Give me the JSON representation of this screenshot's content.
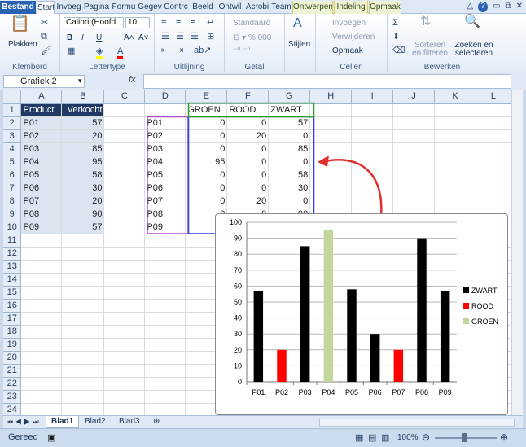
{
  "ribbon_tabs": [
    "Bestand",
    "Start",
    "Invoeg",
    "Pagina",
    "Formu",
    "Gegev",
    "Contrc",
    "Beeld",
    "Ontwil",
    "Acrobi",
    "Team",
    "Ontwerpen",
    "Indeling",
    "Opmaak"
  ],
  "ribbon": {
    "clipboard": {
      "paste": "Plakken",
      "group": "Klembord"
    },
    "font": {
      "name": "Calibri (Hoofd",
      "size": "10",
      "group": "Lettertype"
    },
    "align": {
      "group": "Uitlijning"
    },
    "number": {
      "format": "Standaard",
      "group": "Getal"
    },
    "styles": {
      "label": "Stijlen"
    },
    "cells": {
      "insert": "Invoegen",
      "delete": "Verwijderen",
      "format": "Opmaak",
      "group": "Cellen"
    },
    "edit": {
      "sort": "Sorteren en filteren",
      "find": "Zoeken en selecteren",
      "group": "Bewerken"
    }
  },
  "namebox": "Grafiek 2",
  "fx": "fx",
  "columns": [
    "",
    "A",
    "B",
    "C",
    "D",
    "E",
    "F",
    "G",
    "H",
    "I",
    "J",
    "K",
    "L"
  ],
  "rows": [
    [
      "Product",
      "Verkocht",
      "",
      "",
      "GROEN",
      "ROOD",
      "ZWART"
    ],
    [
      "P01",
      "57",
      "",
      "P01",
      "0",
      "0",
      "57"
    ],
    [
      "P02",
      "20",
      "",
      "P02",
      "0",
      "20",
      "0"
    ],
    [
      "P03",
      "85",
      "",
      "P03",
      "0",
      "0",
      "85"
    ],
    [
      "P04",
      "95",
      "",
      "P04",
      "95",
      "0",
      "0"
    ],
    [
      "P05",
      "58",
      "",
      "P05",
      "0",
      "0",
      "58"
    ],
    [
      "P06",
      "30",
      "",
      "P06",
      "0",
      "0",
      "30"
    ],
    [
      "P07",
      "20",
      "",
      "P07",
      "0",
      "20",
      "0"
    ],
    [
      "P08",
      "90",
      "",
      "P08",
      "0",
      "0",
      "90"
    ],
    [
      "P09",
      "57",
      "",
      "P09",
      "",
      "",
      ""
    ],
    [
      "",
      "",
      "",
      "",
      "",
      "",
      ""
    ],
    [
      "",
      "",
      "",
      "",
      "",
      "",
      ""
    ],
    [
      "",
      "",
      "",
      "",
      "",
      "",
      ""
    ],
    [
      "",
      "",
      "",
      "",
      "",
      "",
      ""
    ],
    [
      "",
      "",
      "",
      "",
      "",
      "",
      ""
    ],
    [
      "",
      "",
      "",
      "",
      "",
      "",
      ""
    ],
    [
      "",
      "",
      "",
      "",
      "",
      "",
      ""
    ],
    [
      "",
      "",
      "",
      "",
      "",
      "",
      ""
    ],
    [
      "",
      "",
      "",
      "",
      "",
      "",
      ""
    ],
    [
      "",
      "",
      "",
      "",
      "",
      "",
      ""
    ],
    [
      "",
      "",
      "",
      "",
      "",
      "",
      ""
    ],
    [
      "",
      "",
      "",
      "",
      "",
      "",
      ""
    ],
    [
      "",
      "",
      "",
      "",
      "",
      "",
      ""
    ],
    [
      "",
      "",
      "",
      "",
      "",
      "",
      ""
    ]
  ],
  "sheets": [
    "Blad1",
    "Blad2",
    "Blad3"
  ],
  "status": {
    "ready": "Gereed",
    "zoom": "100%"
  },
  "colors": {
    "zwart": "#000000",
    "rood": "#ff0000",
    "groen": "#c3d69b",
    "arrow": "#e03030"
  },
  "chart_data": {
    "type": "bar",
    "categories": [
      "P01",
      "P02",
      "P03",
      "P04",
      "P05",
      "P06",
      "P07",
      "P08",
      "P09"
    ],
    "series": [
      {
        "name": "ZWART",
        "values": [
          57,
          0,
          85,
          0,
          58,
          30,
          0,
          90,
          57
        ]
      },
      {
        "name": "ROOD",
        "values": [
          0,
          20,
          0,
          0,
          0,
          0,
          20,
          0,
          0
        ]
      },
      {
        "name": "GROEN",
        "values": [
          0,
          0,
          0,
          95,
          0,
          0,
          0,
          0,
          0
        ]
      }
    ],
    "ylim": [
      0,
      100
    ],
    "yticks": [
      0,
      10,
      20,
      30,
      40,
      50,
      60,
      70,
      80,
      90,
      100
    ],
    "grid": true,
    "legend": "right"
  }
}
